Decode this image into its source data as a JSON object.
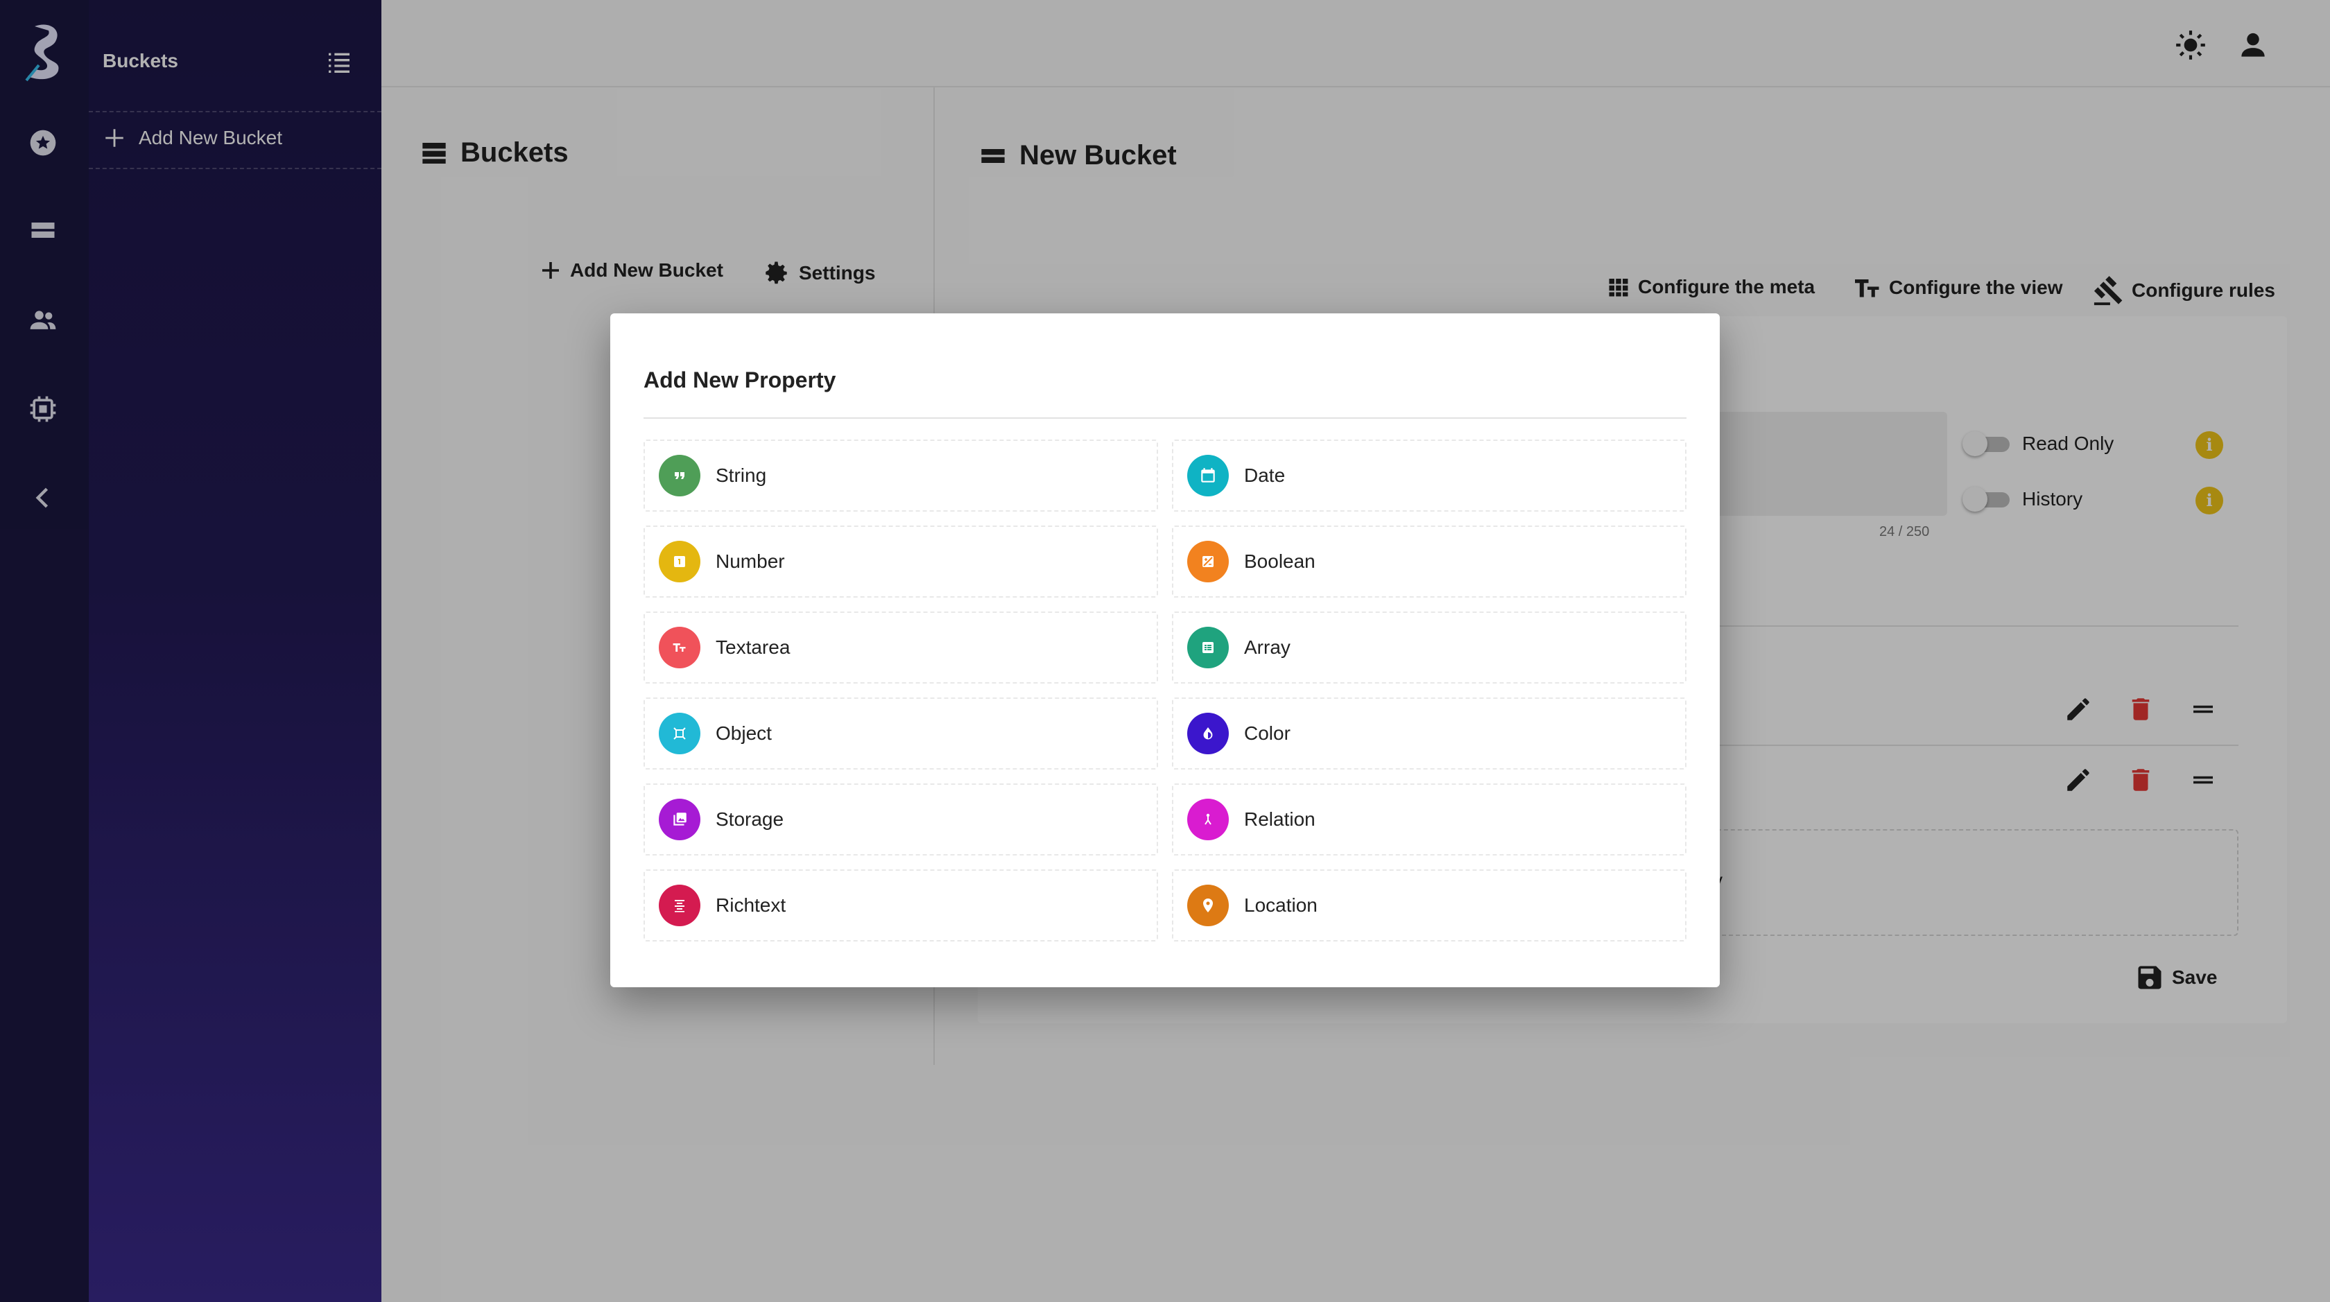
{
  "sidebar": {
    "title": "Buckets",
    "add_label": "Add New Bucket"
  },
  "buckets_panel": {
    "title": "Buckets",
    "add_label": "Add New Bucket",
    "settings_label": "Settings"
  },
  "editor": {
    "title": "New Bucket",
    "actions": {
      "meta": "Configure the meta",
      "view": "Configure the view",
      "rules": "Configure rules"
    },
    "description_counter": "24 / 250",
    "toggles": {
      "read_only": "Read Only",
      "history": "History"
    },
    "partial_text": "y",
    "save_label": "Save"
  },
  "modal": {
    "title": "Add New Property",
    "properties": [
      {
        "label": "String",
        "color": "#4f9e57",
        "icon": "quote-icon"
      },
      {
        "label": "Date",
        "color": "#0fb3c4",
        "icon": "calendar-icon"
      },
      {
        "label": "Number",
        "color": "#e4b710",
        "icon": "number-icon"
      },
      {
        "label": "Boolean",
        "color": "#f2821f",
        "icon": "boolean-icon"
      },
      {
        "label": "Textarea",
        "color": "#f0525a",
        "icon": "text-fields-icon"
      },
      {
        "label": "Array",
        "color": "#1fa37e",
        "icon": "array-icon"
      },
      {
        "label": "Object",
        "color": "#21b9d6",
        "icon": "object-icon"
      },
      {
        "label": "Color",
        "color": "#3b16cc",
        "icon": "color-drop-icon"
      },
      {
        "label": "Storage",
        "color": "#a61bd4",
        "icon": "image-icon"
      },
      {
        "label": "Relation",
        "color": "#d91cd0",
        "icon": "relation-icon"
      },
      {
        "label": "Richtext",
        "color": "#d41b50",
        "icon": "format-align-icon"
      },
      {
        "label": "Location",
        "color": "#dd7a14",
        "icon": "location-pin-icon"
      }
    ]
  },
  "colors": {
    "rail": "#1b1740",
    "nav_gradient_top": "#1d1747",
    "nav_gradient_bottom": "#3a2a8a",
    "delete": "#e53935",
    "info": "#f0c419"
  }
}
